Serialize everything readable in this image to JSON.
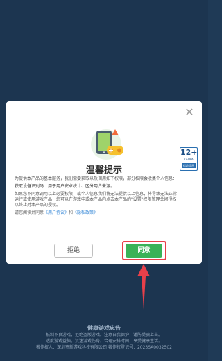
{
  "dialog": {
    "title": "温馨提示",
    "close_label": "✕",
    "age_rating": {
      "number": "12+",
      "org": "CADPA",
      "tag": "适龄提示"
    },
    "paragraphs": [
      "为提供本产品的基本服务，我们需要获取以及调用如下权限，部分权限会收集个人信息：",
      "获取设备识别码：用于用户安卓统计、区分用户来源。",
      "如果您不同意调用以上必要权限，或个人信息我们将无法提供以上信息，将导致无法正常运行或使用游戏产品，您可以在游戏中或本产品内点击本产品的\"设置\"权限管理关闭授权以终止对本产品的授权。"
    ],
    "agree_prefix": "请您阅读并同意",
    "user_agreement": "《用户协议》",
    "and_text": "和",
    "privacy_policy": "《隐私政策》",
    "buttons": {
      "reject": "拒绝",
      "agree": "同意"
    }
  },
  "footer": {
    "title": "健康游戏忠告",
    "line1": "抵制不良游戏，拒绝盗版游戏。注意自我保护，谨防受骗上当。",
    "line2": "适度游戏益脑，沉迷游戏伤身。合理安排时间，享受健康生活。",
    "line3": "著作权人：深圳市新游戏科技有限公司    著作权登记号：2023SA0032502"
  },
  "colors": {
    "backdrop": "#1c3550",
    "agree_button": "#3ab257",
    "highlight_border": "#e8404a",
    "arrow": "#e8404a",
    "link": "#3a8ad8"
  }
}
